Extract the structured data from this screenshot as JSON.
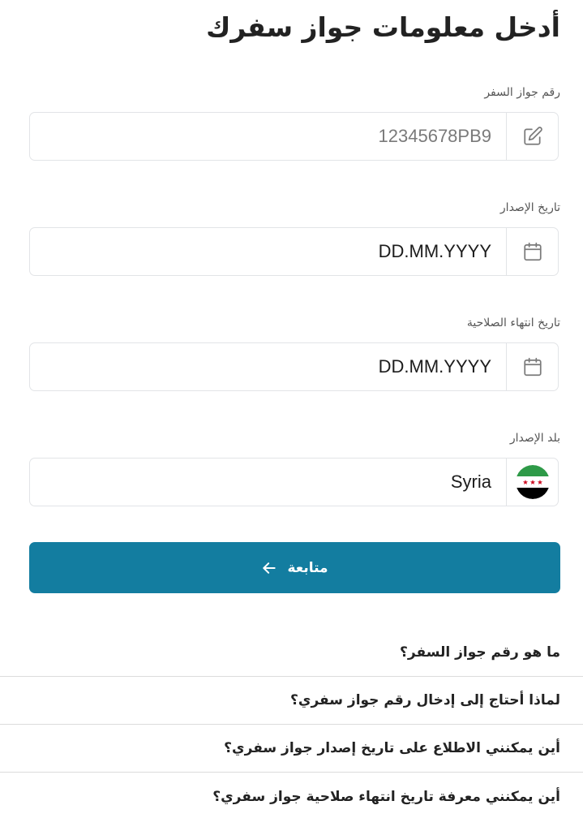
{
  "page": {
    "title": "أدخل معلومات جواز سفرك"
  },
  "fields": {
    "passport_number": {
      "label": "رقم جواز السفر",
      "placeholder": "12345678PB9",
      "icon": "edit-icon"
    },
    "issue_date": {
      "label": "تاريخ الإصدار",
      "value": "DD.MM.YYYY",
      "icon": "calendar-icon"
    },
    "expiry_date": {
      "label": "تاريخ انتهاء الصلاحية",
      "value": "DD.MM.YYYY",
      "icon": "calendar-icon"
    },
    "issuing_country": {
      "label": "بلد الإصدار",
      "value": "Syria",
      "icon": "syria-flag-icon"
    }
  },
  "continue_button": {
    "label": "متابعة",
    "icon": "arrow-left-icon",
    "color": "#137da0"
  },
  "faq": [
    {
      "question": "ما هو رقم جواز السفر؟"
    },
    {
      "question": "لماذا أحتاج إلى إدخال رقم جواز سفري؟"
    },
    {
      "question": "أين يمكنني الاطلاع على تاريخ إصدار جواز سفري؟"
    },
    {
      "question": "أين يمكنني معرفة تاريخ انتهاء صلاحية جواز سفري؟"
    }
  ]
}
